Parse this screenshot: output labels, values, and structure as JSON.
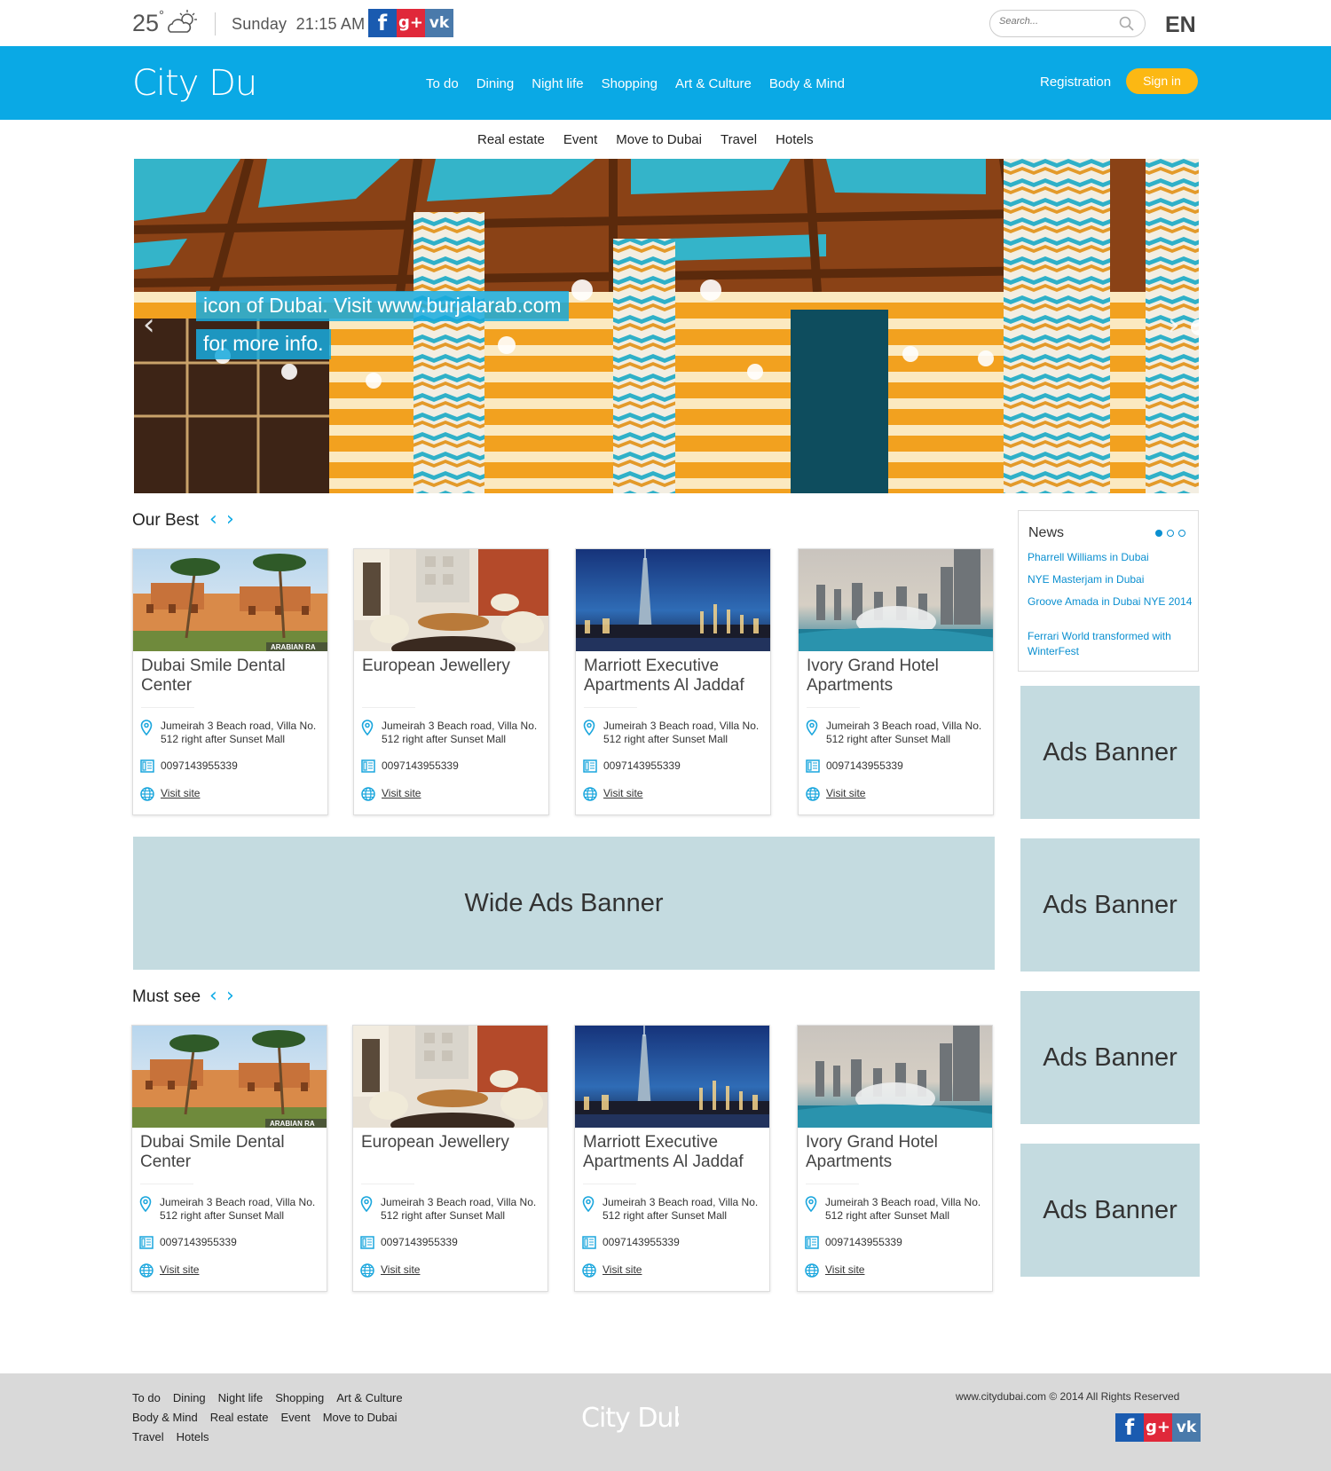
{
  "topbar": {
    "temperature": "25",
    "degree": "°",
    "day": "Sunday",
    "time": "21:15 AM",
    "social": [
      "f",
      "g+",
      "vk"
    ],
    "search_placeholder": "Search...",
    "language": "EN"
  },
  "header": {
    "logo": "City Dubai",
    "nav": [
      "To do",
      "Dining",
      "Night life",
      "Shopping",
      "Art & Culture",
      "Body & Mind"
    ],
    "registration": "Registration",
    "signin": "Sign in"
  },
  "subnav": [
    "Real estate",
    "Event",
    "Move to Dubai",
    "Travel",
    "Hotels"
  ],
  "hero": {
    "caption_line1": "icon of Dubai. Visit www.burjalarab.com",
    "caption_line2": "for more info.",
    "prev_icon": "chevron-left-icon",
    "next_icon": "chevron-right-icon"
  },
  "sections": {
    "our_best": "Our Best",
    "must_see": "Must see"
  },
  "cards": [
    {
      "title": "Dubai Smile Dental Center",
      "address": "Jumeirah 3 Beach road, Villa No. 512 right after Sunset Mall",
      "phone": "0097143955339",
      "link": "Visit site",
      "image_text": "ARABIAN RA"
    },
    {
      "title": "European Jewellery",
      "address": "Jumeirah 3 Beach road, Villa No. 512 right after Sunset Mall",
      "phone": "0097143955339",
      "link": "Visit site"
    },
    {
      "title": "Marriott Executive Apartments Al Jaddaf",
      "address": "Jumeirah 3 Beach road, Villa No. 512 right after Sunset Mall",
      "phone": "0097143955339",
      "link": "Visit site"
    },
    {
      "title": "Ivory Grand Hotel Apartments",
      "address": "Jumeirah 3 Beach road, Villa No. 512 right after Sunset Mall",
      "phone": "0097143955339",
      "link": "Visit site"
    }
  ],
  "news": {
    "title": "News",
    "items": [
      "Pharrell Williams in Dubai",
      "NYE Masterjam in Dubai",
      "Groove Amada in Dubai NYE 2014",
      "Ferrari World transformed with WinterFest"
    ]
  },
  "ads": {
    "side": "Ads Banner",
    "wide": "Wide Ads Banner"
  },
  "footer": {
    "links_row1": [
      "To do",
      "Dining",
      "Night life",
      "Shopping",
      "Art & Culture"
    ],
    "links_row2": [
      "Body & Mind",
      "Real estate",
      "Event",
      "Move to Dubai"
    ],
    "links_row3": [
      "Travel",
      "Hotels"
    ],
    "logo": "City Dubai",
    "copyright": "www.citydubai.com © 2014  All Rights Reserved"
  },
  "colors": {
    "brand_blue": "#0aa9e5",
    "signin_yellow": "#fcb813",
    "ad_bg": "#c4dbe0",
    "footer_bg": "#d9d9d9"
  }
}
